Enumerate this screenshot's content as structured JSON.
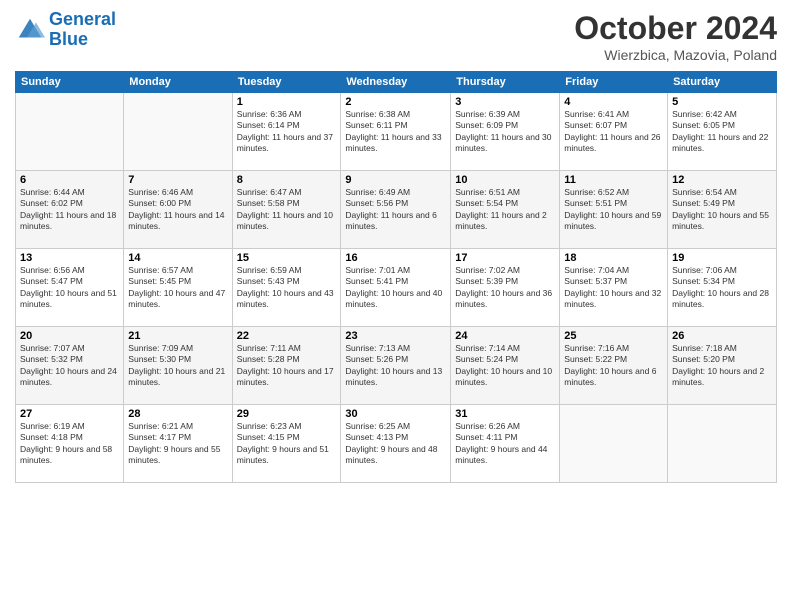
{
  "header": {
    "logo_line1": "General",
    "logo_line2": "Blue",
    "month": "October 2024",
    "location": "Wierzbica, Mazovia, Poland"
  },
  "days_of_week": [
    "Sunday",
    "Monday",
    "Tuesday",
    "Wednesday",
    "Thursday",
    "Friday",
    "Saturday"
  ],
  "weeks": [
    [
      {
        "num": "",
        "info": ""
      },
      {
        "num": "",
        "info": ""
      },
      {
        "num": "1",
        "info": "Sunrise: 6:36 AM\nSunset: 6:14 PM\nDaylight: 11 hours and 37 minutes."
      },
      {
        "num": "2",
        "info": "Sunrise: 6:38 AM\nSunset: 6:11 PM\nDaylight: 11 hours and 33 minutes."
      },
      {
        "num": "3",
        "info": "Sunrise: 6:39 AM\nSunset: 6:09 PM\nDaylight: 11 hours and 30 minutes."
      },
      {
        "num": "4",
        "info": "Sunrise: 6:41 AM\nSunset: 6:07 PM\nDaylight: 11 hours and 26 minutes."
      },
      {
        "num": "5",
        "info": "Sunrise: 6:42 AM\nSunset: 6:05 PM\nDaylight: 11 hours and 22 minutes."
      }
    ],
    [
      {
        "num": "6",
        "info": "Sunrise: 6:44 AM\nSunset: 6:02 PM\nDaylight: 11 hours and 18 minutes."
      },
      {
        "num": "7",
        "info": "Sunrise: 6:46 AM\nSunset: 6:00 PM\nDaylight: 11 hours and 14 minutes."
      },
      {
        "num": "8",
        "info": "Sunrise: 6:47 AM\nSunset: 5:58 PM\nDaylight: 11 hours and 10 minutes."
      },
      {
        "num": "9",
        "info": "Sunrise: 6:49 AM\nSunset: 5:56 PM\nDaylight: 11 hours and 6 minutes."
      },
      {
        "num": "10",
        "info": "Sunrise: 6:51 AM\nSunset: 5:54 PM\nDaylight: 11 hours and 2 minutes."
      },
      {
        "num": "11",
        "info": "Sunrise: 6:52 AM\nSunset: 5:51 PM\nDaylight: 10 hours and 59 minutes."
      },
      {
        "num": "12",
        "info": "Sunrise: 6:54 AM\nSunset: 5:49 PM\nDaylight: 10 hours and 55 minutes."
      }
    ],
    [
      {
        "num": "13",
        "info": "Sunrise: 6:56 AM\nSunset: 5:47 PM\nDaylight: 10 hours and 51 minutes."
      },
      {
        "num": "14",
        "info": "Sunrise: 6:57 AM\nSunset: 5:45 PM\nDaylight: 10 hours and 47 minutes."
      },
      {
        "num": "15",
        "info": "Sunrise: 6:59 AM\nSunset: 5:43 PM\nDaylight: 10 hours and 43 minutes."
      },
      {
        "num": "16",
        "info": "Sunrise: 7:01 AM\nSunset: 5:41 PM\nDaylight: 10 hours and 40 minutes."
      },
      {
        "num": "17",
        "info": "Sunrise: 7:02 AM\nSunset: 5:39 PM\nDaylight: 10 hours and 36 minutes."
      },
      {
        "num": "18",
        "info": "Sunrise: 7:04 AM\nSunset: 5:37 PM\nDaylight: 10 hours and 32 minutes."
      },
      {
        "num": "19",
        "info": "Sunrise: 7:06 AM\nSunset: 5:34 PM\nDaylight: 10 hours and 28 minutes."
      }
    ],
    [
      {
        "num": "20",
        "info": "Sunrise: 7:07 AM\nSunset: 5:32 PM\nDaylight: 10 hours and 24 minutes."
      },
      {
        "num": "21",
        "info": "Sunrise: 7:09 AM\nSunset: 5:30 PM\nDaylight: 10 hours and 21 minutes."
      },
      {
        "num": "22",
        "info": "Sunrise: 7:11 AM\nSunset: 5:28 PM\nDaylight: 10 hours and 17 minutes."
      },
      {
        "num": "23",
        "info": "Sunrise: 7:13 AM\nSunset: 5:26 PM\nDaylight: 10 hours and 13 minutes."
      },
      {
        "num": "24",
        "info": "Sunrise: 7:14 AM\nSunset: 5:24 PM\nDaylight: 10 hours and 10 minutes."
      },
      {
        "num": "25",
        "info": "Sunrise: 7:16 AM\nSunset: 5:22 PM\nDaylight: 10 hours and 6 minutes."
      },
      {
        "num": "26",
        "info": "Sunrise: 7:18 AM\nSunset: 5:20 PM\nDaylight: 10 hours and 2 minutes."
      }
    ],
    [
      {
        "num": "27",
        "info": "Sunrise: 6:19 AM\nSunset: 4:18 PM\nDaylight: 9 hours and 58 minutes."
      },
      {
        "num": "28",
        "info": "Sunrise: 6:21 AM\nSunset: 4:17 PM\nDaylight: 9 hours and 55 minutes."
      },
      {
        "num": "29",
        "info": "Sunrise: 6:23 AM\nSunset: 4:15 PM\nDaylight: 9 hours and 51 minutes."
      },
      {
        "num": "30",
        "info": "Sunrise: 6:25 AM\nSunset: 4:13 PM\nDaylight: 9 hours and 48 minutes."
      },
      {
        "num": "31",
        "info": "Sunrise: 6:26 AM\nSunset: 4:11 PM\nDaylight: 9 hours and 44 minutes."
      },
      {
        "num": "",
        "info": ""
      },
      {
        "num": "",
        "info": ""
      }
    ]
  ]
}
